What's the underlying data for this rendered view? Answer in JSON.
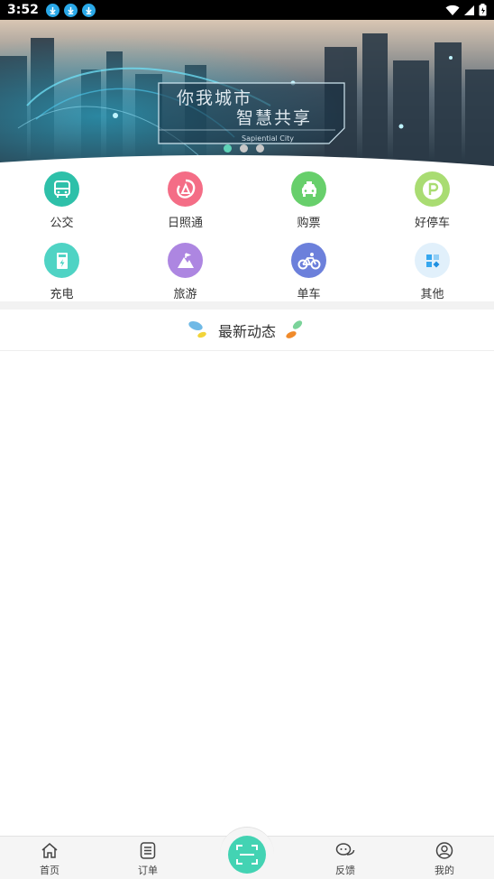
{
  "status_bar": {
    "time": "3:52"
  },
  "banner": {
    "title_line1": "你我城市",
    "title_line2": "智慧共享",
    "subtitle": "Sapiential City",
    "active_dot": 0,
    "dot_count": 3
  },
  "services": [
    {
      "label": "公交",
      "icon": "bus-icon",
      "color": "#2ec0a9"
    },
    {
      "label": "日照通",
      "icon": "rizhaotong-logo-icon",
      "color": "#f46d86"
    },
    {
      "label": "购票",
      "icon": "taxi-icon",
      "color": "#67cf6b"
    },
    {
      "label": "好停车",
      "icon": "parking-icon",
      "color": "#a9dc72"
    },
    {
      "label": "充电",
      "icon": "charging-station-icon",
      "color": "#4fd3c4"
    },
    {
      "label": "旅游",
      "icon": "mountain-icon",
      "color": "#ad86e1"
    },
    {
      "label": "单车",
      "icon": "bicycle-icon",
      "color": "#6c80db"
    },
    {
      "label": "其他",
      "icon": "more-apps-icon",
      "color": "#e1f0fb"
    }
  ],
  "news": {
    "title": "最新动态"
  },
  "tabbar": {
    "home": "首页",
    "orders": "订单",
    "feedback": "反馈",
    "mine": "我的",
    "accent": "#43d3b3"
  }
}
